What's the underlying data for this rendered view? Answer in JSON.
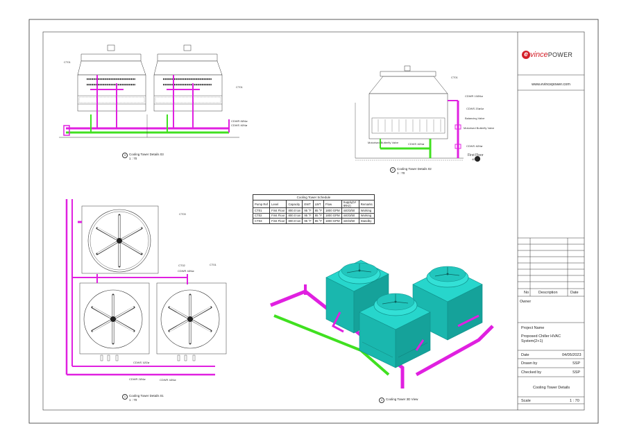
{
  "title_block": {
    "brand": "evincePOWER",
    "brand_e": "e",
    "brand_rest": "vince",
    "brand_power": "POWER",
    "website": "www.evincepower.com",
    "rev_headers": [
      "No",
      "Description",
      "Date"
    ],
    "owner_label": "Owner",
    "project_name_label": "Project Name",
    "project_name": "Proposed Chiller HVAC System(2+1)",
    "date_label": "Date",
    "date_value": "04/05/2023",
    "drawn_label": "Drawn by",
    "drawn_value": "SSP",
    "checked_label": "Checked by",
    "checked_value": "SSP",
    "sheet_title": "Cooling Tower Details",
    "scale_label": "Scale",
    "scale_value": "1 : 70"
  },
  "colors": {
    "border": "#333333",
    "pipe_magenta": "#e020e0",
    "pipe_green": "#40e020",
    "tower_cyan": "#1ecfc6",
    "tower_cyan_dark": "#0f8f8a",
    "brand_red": "#d4202a"
  },
  "views": {
    "v3": {
      "number": "3",
      "title": "Cooling Tower Details 03",
      "scale": "1 : 70",
      "labels": {
        "ct01": "CT01",
        "ct01b": "CT01",
        "cdwr": "CDWR 8Ø4ø",
        "cdws": "CDWS 4Ø4ø"
      }
    },
    "v2": {
      "number": "2",
      "title": "Cooling Tower Details 02",
      "scale": "1 : 70",
      "labels": {
        "ct01": "CT01",
        "cdwr": "CDWR 10Ø4ø",
        "cdws": "CDWS 20ø4ø",
        "balancing": "Balancing Valve",
        "motorised": "Motorised Butterfly Valve",
        "motorised2": "Motorised Butterfly Valve",
        "cdws2": "CDWS 4Ø4ø",
        "cdws3": "CDWS 4Ø4ø",
        "first_floor": "First Floor",
        "level": "4000"
      }
    },
    "v1": {
      "number": "1",
      "title": "Cooling Tower Details 01",
      "scale": "1 : 70",
      "labels": {
        "ct03": "CT03",
        "ct02": "CT02",
        "ct01": "CT01",
        "cdwr": "CDWR 4Ø4ø",
        "cdws": "CDWS 1Ø2ø",
        "cdwr2": "CDWR 2Ø4ø",
        "cdwr3": "CDWR 4Ø4ø"
      }
    },
    "v4": {
      "number": "4",
      "title": "Cooling Tower 3D View"
    }
  },
  "schedule": {
    "caption": "Cooling Tower Schedule",
    "headers": [
      "Pump Ref",
      "Level",
      "Capacity",
      "EWT",
      "LWT",
      "Flow",
      "Supply(V/Ф/Hz)",
      "Remarks"
    ],
    "rows": [
      [
        "CT01",
        "First Floor",
        "800.0 ton",
        "95 °F",
        "85 °F",
        "1800 GPM",
        "440/3/50",
        "Working"
      ],
      [
        "CT02",
        "First Floor",
        "800.0 ton",
        "95 °F",
        "85 °F",
        "1800 GPM",
        "440/3/50",
        "Working"
      ],
      [
        "CT03",
        "First Floor",
        "800.0 ton",
        "95 °F",
        "85 °F",
        "1800 GPM",
        "440/3/50",
        "Standby"
      ]
    ]
  }
}
